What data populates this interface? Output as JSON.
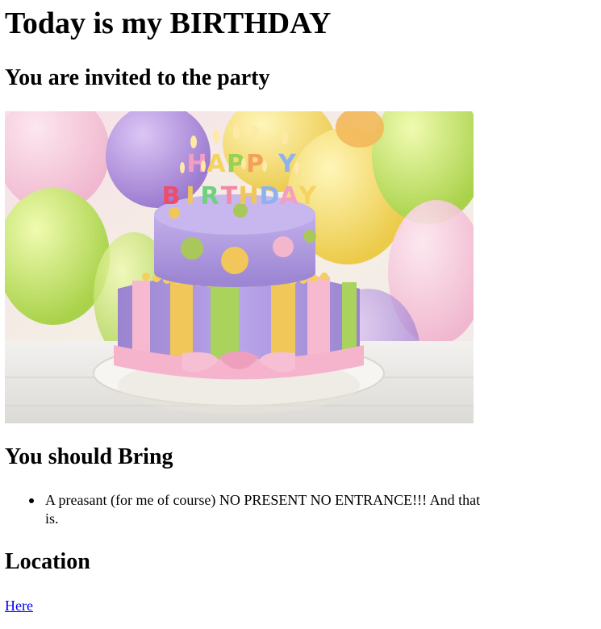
{
  "page": {
    "title": "Today is my BIRTHDAY",
    "subtitle": "You are invited to the party"
  },
  "image": {
    "subject": "birthday cake",
    "cake_text": "HAPPY BIRTHDAY",
    "colors": {
      "balloon_purple": "#a98ad8",
      "balloon_green": "#c8e66b",
      "balloon_yellow": "#f4dd68",
      "cake_lavender": "#ad96dd",
      "stripe_green": "#a9d35c",
      "stripe_yellow": "#f0c95a",
      "ribbon_pink": "#f7b8cf",
      "table_white": "#f0efed"
    }
  },
  "bring": {
    "heading": "You should Bring",
    "items": [
      "A preasant (for me of course) NO PRESENT NO ENTRANCE!!! And that is."
    ]
  },
  "location": {
    "heading": "Location",
    "link_label": "Here"
  }
}
